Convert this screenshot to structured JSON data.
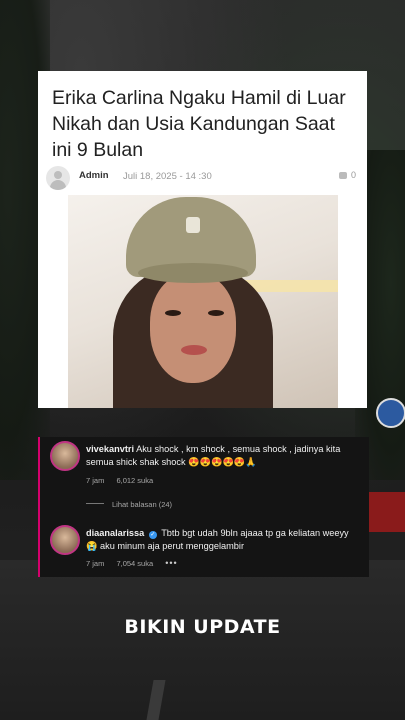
{
  "article": {
    "title": "Erika Carlina Ngaku Hamil di Luar Nikah dan Usia Kandungan Saat ini 9 Bulan",
    "author": "Admin",
    "date": "Juli 18, 2025 - 14 :30",
    "comment_count": "0",
    "author_avatar_icon": "default-user-icon",
    "comment_icon": "comment-bubble-icon"
  },
  "comments": [
    {
      "username": "vivekanvtri",
      "text": "Aku shock , km shock , semua shock , jadinya kita semua shick shak shock 😍😍😍😍😍🙏",
      "time": "7 jam",
      "likes": "6,012 suka",
      "replies": "Lihat balasan (24)"
    },
    {
      "username": "diaanalarissa",
      "verified": true,
      "text": "Tbtb bgt udah 9bln ajaaa tp ga keliatan weeyy 😭 aku minum aja perut menggelambir",
      "time": "7 jam",
      "likes": "7,054 suka",
      "more": "•••"
    }
  ],
  "caption": "BIKIN UPDATE",
  "colors": {
    "comment_accent": "#d5006d",
    "verified_badge": "#3897f0"
  }
}
